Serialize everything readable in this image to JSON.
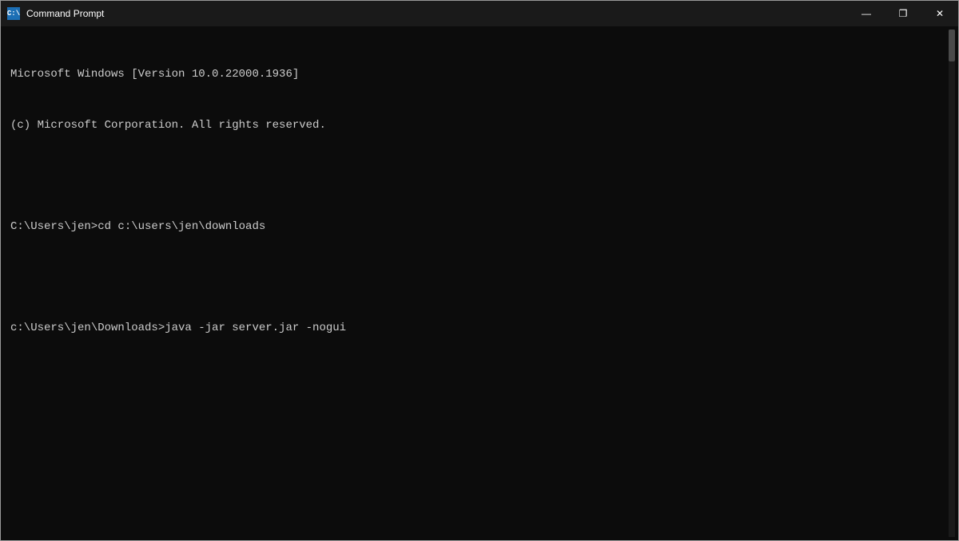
{
  "window": {
    "title": "Command Prompt",
    "icon_label": "C:",
    "controls": {
      "minimize": "—",
      "maximize": "❐",
      "close": "✕"
    }
  },
  "terminal": {
    "lines": [
      "Microsoft Windows [Version 10.0.22000.1936]",
      "(c) Microsoft Corporation. All rights reserved.",
      "",
      "C:\\Users\\jen>cd c:\\users\\jen\\downloads",
      "",
      "c:\\Users\\jen\\Downloads>java -jar server.jar -nogui"
    ]
  },
  "colors": {
    "titlebar_bg": "#1a1a1a",
    "terminal_bg": "#0c0c0c",
    "text_color": "#cccccc"
  }
}
